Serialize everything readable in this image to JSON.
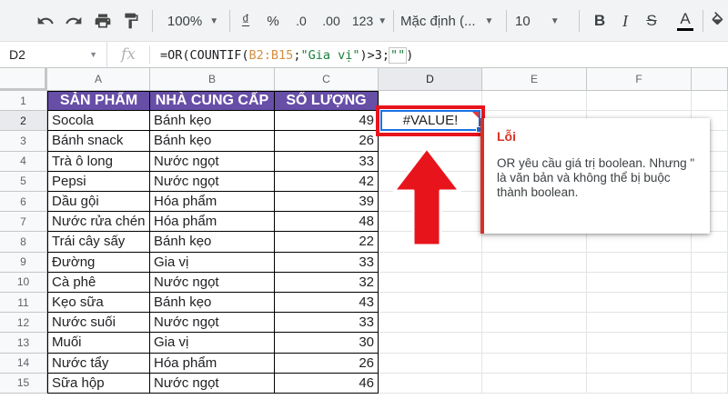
{
  "toolbar": {
    "zoom": "100%",
    "currency": "₫",
    "percent": "%",
    "dec_decrease": ".0",
    "dec_increase": ".00",
    "more_formats": "123",
    "font": "Mặc định (...",
    "font_size": "10",
    "bold": "B",
    "italic": "I",
    "strike": "S",
    "text_color": "A"
  },
  "name_box": "D2",
  "formula_bar": {
    "fx": "fx",
    "p1": "=OR(COUNTIF(",
    "range": "B2:B15",
    "p2": ";",
    "string": "\"Gia vị\"",
    "p3": ")>3;",
    "sel": "\"\"",
    "p4": ")"
  },
  "columns": [
    "A",
    "B",
    "C",
    "D",
    "E",
    "F"
  ],
  "rows": [
    "1",
    "2",
    "3",
    "4",
    "5",
    "6",
    "7",
    "8",
    "9",
    "10",
    "11",
    "12",
    "13",
    "14",
    "15"
  ],
  "table": {
    "headers": [
      "SẢN PHẨM",
      "NHÀ CUNG CẤP",
      "SỐ LƯỢNG"
    ],
    "rows": [
      [
        "Socola",
        "Bánh kẹo",
        "49"
      ],
      [
        "Bánh snack",
        "Bánh kẹo",
        "26"
      ],
      [
        "Trà ô long",
        "Nước ngọt",
        "33"
      ],
      [
        "Pepsi",
        "Nước ngọt",
        "42"
      ],
      [
        "Dầu gội",
        "Hóa phẩm",
        "39"
      ],
      [
        "Nước rửa chén",
        "Hóa phẩm",
        "48"
      ],
      [
        "Trái cây sấy",
        "Bánh kẹo",
        "22"
      ],
      [
        "Đường",
        "Gia vị",
        "33"
      ],
      [
        "Cà phê",
        "Nước ngọt",
        "32"
      ],
      [
        "Kẹo sữa",
        "Bánh kẹo",
        "43"
      ],
      [
        "Nước suối",
        "Nước ngọt",
        "33"
      ],
      [
        "Muối",
        "Gia vị",
        "30"
      ],
      [
        "Nước tẩy",
        "Hóa phẩm",
        "26"
      ],
      [
        "Sữa hộp",
        "Nước ngọt",
        "46"
      ]
    ]
  },
  "d2_value": "#VALUE!",
  "error_popup": {
    "title": "Lỗi",
    "message": "OR yêu cầu giá trị boolean. Nhưng \" là văn bản và không thể bị buộc thành boolean."
  },
  "colors": {
    "header_bg": "#674ea7",
    "highlight": "#e8141c",
    "selection": "#1a73e8",
    "error": "#d93025"
  }
}
